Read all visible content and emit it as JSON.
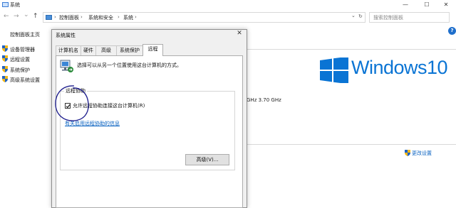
{
  "window": {
    "title": "系统",
    "minimize_glyph": "—",
    "maximize_glyph": "☐",
    "close_glyph": "✕"
  },
  "nav": {
    "back_icon": "←",
    "forward_icon": "→",
    "recent_icon": "⌄",
    "up_icon": "↑",
    "refresh_icon": "↻",
    "dropdown_icon": "⌄"
  },
  "breadcrumb": {
    "sep": "›",
    "items": [
      "控制面板",
      "系统和安全",
      "系统"
    ]
  },
  "search": {
    "placeholder": "搜索控制面板"
  },
  "sidebar": {
    "home": "控制面板主页",
    "items": [
      {
        "label": "设备管理器",
        "icon": "shield-icon"
      },
      {
        "label": "远程设置",
        "icon": "shield-icon"
      },
      {
        "label": "系统保护",
        "icon": "shield-icon"
      },
      {
        "label": "高级系统设置",
        "icon": "shield-icon"
      }
    ]
  },
  "help_glyph": "?",
  "main": {
    "brand_text": "Windows10",
    "cpu_info": "GHz   3.70 GHz",
    "change_settings": "更改设置"
  },
  "dialog": {
    "title": "系统属性",
    "close_glyph": "✕",
    "tabs": [
      "计算机名",
      "硬件",
      "高级",
      "系统保护",
      "远程"
    ],
    "active_tab": "远程",
    "description": "选择可以从另一个位置使用这台计算机的方式。",
    "group_label": "远程协助",
    "checkbox_label": "允许远程协助连接这台计算机(R)",
    "checkbox_checked": true,
    "help_link": "有关启用远程协助的信息",
    "advanced_button": "高级(V)..."
  },
  "colors": {
    "accent_blue": "#0a74d4",
    "link_blue": "#0b63c1",
    "annotation_circle": "#1b1b8c"
  }
}
